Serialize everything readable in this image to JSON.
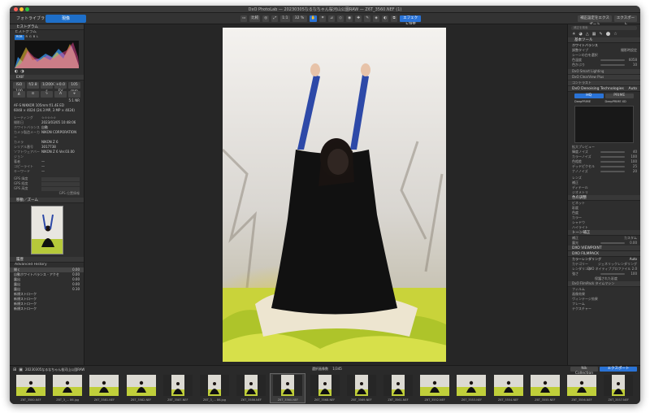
{
  "window": {
    "title": "DxO PhotoLab — 20230305なるなちゃん桜河山公園RAW — Z6T_3560.NEF (1)"
  },
  "toolbar": {
    "tab_library": "フォトライブラリ",
    "tab_edit": "現像",
    "compare_label": "比較",
    "zoom_fit": "1:1",
    "zoom_level": "32 %",
    "right_btn_1": "補正設定をエクスポート",
    "right_btn_2": "エクスポート",
    "mode_btn": "エフェクト設定"
  },
  "left_panel": {
    "histogram_header": "ヒストグラム",
    "histogram_sub": "ヒストグラム",
    "channel_tabs": [
      "RGB",
      "R",
      "G",
      "B",
      "L"
    ],
    "exif_header": "EXIF",
    "exif_values": [
      "ISO 100",
      "f/2.8",
      "1/2000 s",
      "+0.0 EV",
      "105 mm"
    ],
    "lens_ratio": "5:1 NR",
    "lens_name": "AF-S NIKKOR 105mm f/1.4E ED",
    "dims": "6048 × 4024 (24.3 MP, 3 MP × 4024)",
    "meta": [
      {
        "k": "レーティング",
        "v": "☆☆☆☆☆"
      },
      {
        "k": "撮影日",
        "v": "2023/03/05 10:48:06"
      },
      {
        "k": "ホワイトバランス",
        "v": "自動"
      },
      {
        "k": "カメラ製造メーカー",
        "v": "NIKON CORPORATION"
      },
      {
        "k": "カメラ",
        "v": "NIKON Z 6"
      },
      {
        "k": "シリアル番号",
        "v": "3017738"
      },
      {
        "k": "ソフトウェアバージョン",
        "v": "NIKON Z 6 Ver.03.00"
      },
      {
        "k": "著者",
        "v": "—"
      },
      {
        "k": "コピーライト",
        "v": "—"
      },
      {
        "k": "キーワード",
        "v": "—"
      }
    ],
    "gps": [
      {
        "k": "GPS 緯度",
        "v": ""
      },
      {
        "k": "GPS 経度",
        "v": ""
      },
      {
        "k": "GPS 高度",
        "v": ""
      }
    ],
    "gps_footer": "GPS 位置情報",
    "navigator_header": "移動／ズーム",
    "history_header": "履歴",
    "history_sub": "Advanced History",
    "history_rows": [
      {
        "name": "開く",
        "val": "0.00"
      },
      {
        "name": "自動ホワイトバランス - アクセ",
        "val": "0.00"
      },
      {
        "name": "露出",
        "val": "0.00"
      },
      {
        "name": "露出",
        "val": "0.00"
      },
      {
        "name": "露出",
        "val": "0.10"
      },
      {
        "name": "新規ストローク",
        "val": ""
      },
      {
        "name": "新規ストローク",
        "val": ""
      },
      {
        "name": "新規ストローク",
        "val": ""
      },
      {
        "name": "新規ストローク",
        "val": ""
      }
    ]
  },
  "right_panel": {
    "search_placeholder": "補正を検索",
    "basic_header": "基本ツール",
    "wb_header": "ホワイトバランス",
    "wb_rows": [
      {
        "k": "調整タイプ",
        "v": "撮影時設定"
      },
      {
        "k": "シーンの白を選択",
        "v": ""
      },
      {
        "k": "色温度",
        "v": "6058"
      },
      {
        "k": "色かぶり",
        "v": "10"
      }
    ],
    "sections_a": [
      "DxO Smart Lighting",
      "DxO ClearView Plus",
      "コントラスト"
    ],
    "denoise_header": "DxO Denoising Technologies",
    "denoise_mode": "Auto",
    "denoise_tabs": [
      "HQ",
      "PRIME"
    ],
    "denoise_options": [
      "DeepPRIME",
      "DeepPRIME XD"
    ],
    "denoise_rows": [
      {
        "k": "拡大プレビュー",
        "v": ""
      },
      {
        "k": "輝度ノイズ",
        "v": "40"
      },
      {
        "k": "カラーノイズ",
        "v": "100"
      },
      {
        "k": "色相差",
        "v": "100"
      },
      {
        "k": "デッドピクセル",
        "v": "25"
      },
      {
        "k": "ナノノイズ",
        "v": "20"
      }
    ],
    "sections_b": [
      "レンズ",
      "補正",
      "ディテール",
      "ジオメトリ"
    ],
    "color_header": "色の調整",
    "color_rows": [
      "ビネット",
      "彩度",
      "色度",
      "カラー",
      "シャドウ",
      "ハイライト"
    ],
    "tone_header": "トーン補正",
    "tone_rows": [
      {
        "k": "補正",
        "v": "カスタム"
      },
      {
        "k": "露光",
        "v": "0.00"
      }
    ],
    "viewpoint_header": "DXO VIEWPOINT",
    "filmpack_header": "DXO FILMPACK",
    "rendering_header": "カラーレンダリング",
    "rendering_mode": "Auto",
    "rendering_rows": [
      {
        "k": "カテゴリー",
        "v": "ジェネリックレンダリング"
      },
      {
        "k": "レンダリング",
        "v": "DxO ネイティブプロファイル 2.0"
      },
      {
        "k": "強さ",
        "v": "100"
      }
    ],
    "rendering_footer": "保護された彩度",
    "filmpack_items": [
      "DxO FilmPack タイムマシン"
    ],
    "sections_c": [
      "フィルム",
      "画像効果",
      "ヴィンテージ効果",
      "フレーム",
      "テクスチャー"
    ]
  },
  "filmstrip": {
    "folder": "20230305なるなちゃん桜河山公園RAW",
    "count": "選択画像数",
    "count_value": "1/345",
    "nik_label": "Nik Collection",
    "export_label": "エクスポート",
    "thumbs": [
      "Z6T_3580.NEF",
      "Z6T_3_... 86.jpg",
      "Z6T_3581.NEF",
      "Z6T_3582.NEF",
      "Z6T_3587.NEF",
      "Z6T_3_... 86.jpg",
      "Z6T_3586.NEF",
      "Z6T_3560.NEF",
      "Z6T_3568.NEF",
      "Z6T_3569.NEF",
      "Z6T_3561.NEF",
      "Z6T_3552.NEF",
      "Z6T_3553.NEF",
      "Z6T_3554.NEF",
      "Z6T_3555.NEF",
      "Z6T_3556.NEF",
      "Z6T_3557.NEF"
    ],
    "thumb_kinds": [
      "w",
      "w",
      "w",
      "w",
      "p",
      "p",
      "p",
      "p",
      "p",
      "p",
      "p",
      "w",
      "w",
      "w",
      "w",
      "w",
      "p"
    ]
  }
}
